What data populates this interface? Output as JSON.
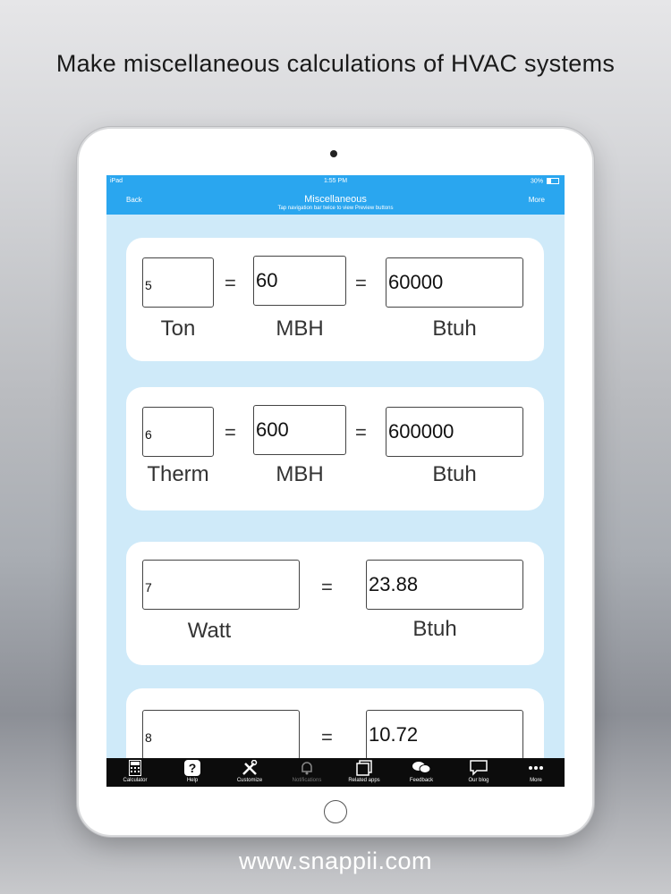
{
  "headline": "Make miscellaneous calculations of HVAC systems",
  "footer": "www.snappii.com",
  "status_bar": {
    "device": "iPad",
    "time": "1:55 PM",
    "battery": "30%"
  },
  "nav": {
    "back": "Back",
    "title": "Miscellaneous",
    "subtitle": "Tap navigation bar twice to view Preview buttons",
    "more": "More"
  },
  "rows": [
    {
      "inputs": [
        "5",
        "60",
        "60000"
      ],
      "equals": [
        "=",
        "="
      ],
      "units": [
        "Ton",
        "MBH",
        "Btuh"
      ]
    },
    {
      "inputs": [
        "6",
        "600",
        "600000"
      ],
      "equals": [
        "=",
        "="
      ],
      "units": [
        "Therm",
        "MBH",
        "Btuh"
      ]
    },
    {
      "inputs": [
        "7",
        "23.88"
      ],
      "equals": [
        "="
      ],
      "units": [
        "Watt",
        "Btuh"
      ]
    },
    {
      "inputs": [
        "8",
        "10.72"
      ],
      "equals": [
        "="
      ],
      "units": []
    }
  ],
  "tabs": [
    {
      "label": "Calculator",
      "icon": "calculator-icon"
    },
    {
      "label": "Help",
      "icon": "help-icon"
    },
    {
      "label": "Customize",
      "icon": "tools-icon"
    },
    {
      "label": "Notifications",
      "icon": "bell-icon"
    },
    {
      "label": "Related apps",
      "icon": "apps-icon"
    },
    {
      "label": "Feedback",
      "icon": "chat-icon"
    },
    {
      "label": "Our blog",
      "icon": "speech-bubble-icon"
    },
    {
      "label": "More",
      "icon": "more-dots-icon"
    }
  ],
  "colors": {
    "nav": "#2aa6ef",
    "screen_bg": "#cfeaf9",
    "tabbar": "#0c0c0c"
  }
}
